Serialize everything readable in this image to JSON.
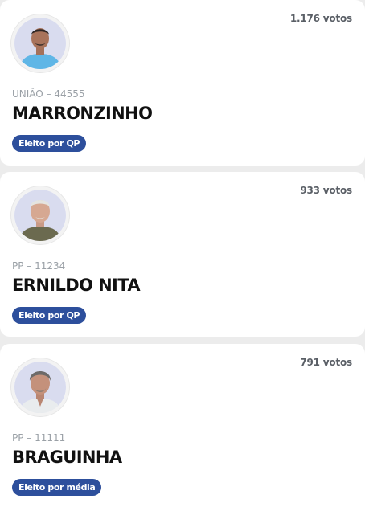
{
  "candidates": [
    {
      "votes": "1.176 votos",
      "party_number": "UNIÃO – 44555",
      "name": "MARRONZINHO",
      "status": "Eleito por QP",
      "photo": "candidate-photo-blue-shirt",
      "shirt_color": "#5fb6e6"
    },
    {
      "votes": "933 votos",
      "party_number": "PP – 11234",
      "name": "ERNILDO NITA",
      "status": "Eleito por QP",
      "photo": "candidate-photo-white-hair",
      "shirt_color": "#6b6a4f"
    },
    {
      "votes": "791 votos",
      "party_number": "PP – 11111",
      "name": "BRAGUINHA",
      "status": "Eleito por média",
      "photo": "candidate-photo-grey-hair",
      "shirt_color": "#e9ecee"
    }
  ],
  "colors": {
    "badge": "#2d4f9c",
    "avatar_bg": "#d8dbf0"
  }
}
